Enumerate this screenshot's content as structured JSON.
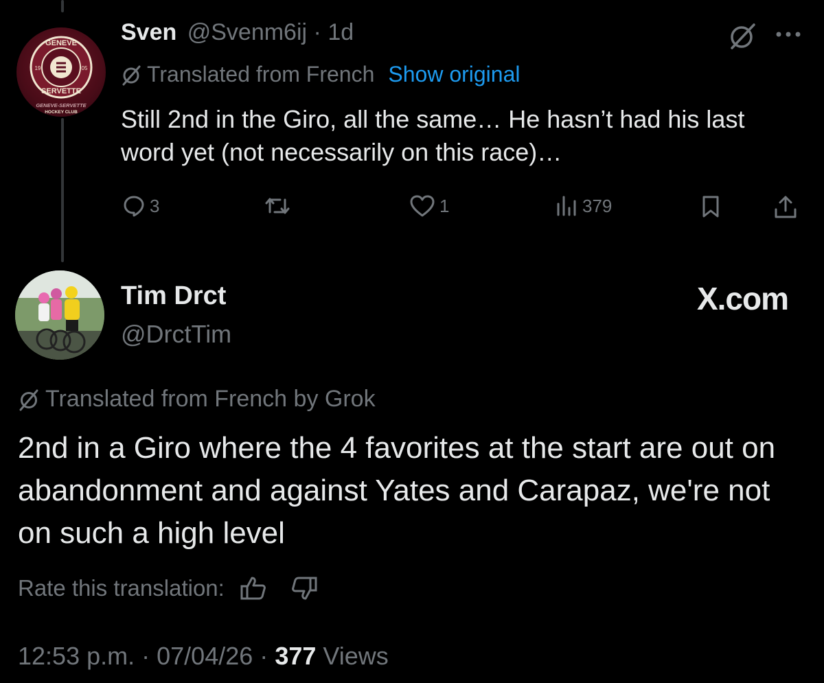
{
  "reply": {
    "author_name": "Sven",
    "handle": "@Svenm6ij",
    "separator": "·",
    "time": "1d",
    "translated_label": "Translated from French",
    "show_original": "Show original",
    "text": "Still 2nd in the Giro, all the same… He hasn’t had his last word yet (not necessarily on this race)…",
    "replies": "3",
    "likes": "1",
    "views": "379",
    "avatar": {
      "top_text": "GENEVE",
      "bottom_text": "SERVETTE",
      "year_left": "19",
      "year_right": "05",
      "club_line1": "GENEVE-SERVETTE",
      "club_line2": "HOCKEY CLUB"
    }
  },
  "main": {
    "author_name": "Tim Drct",
    "handle": "@DrctTim",
    "watermark": "X.com",
    "translated_label": "Translated from French by Grok",
    "text": "2nd in a Giro where the 4 favorites at the start are out on abandonment and against Yates and Carapaz, we're not on such a high level",
    "rate_label": "Rate this translation:",
    "time": "12:53 p.m.",
    "date": "07/04/26",
    "separator": "·",
    "views_count": "377",
    "views_label": "Views"
  },
  "colors": {
    "background": "#000000",
    "text": "#e7e9ea",
    "muted": "#71767b",
    "link": "#1d9bf0",
    "thread_line": "#333639"
  },
  "icons": [
    "translate-icon",
    "grok-icon",
    "more-icon",
    "reply-icon",
    "retweet-icon",
    "like-icon",
    "views-icon",
    "bookmark-icon",
    "share-icon",
    "thumbs-up-icon",
    "thumbs-down-icon"
  ]
}
